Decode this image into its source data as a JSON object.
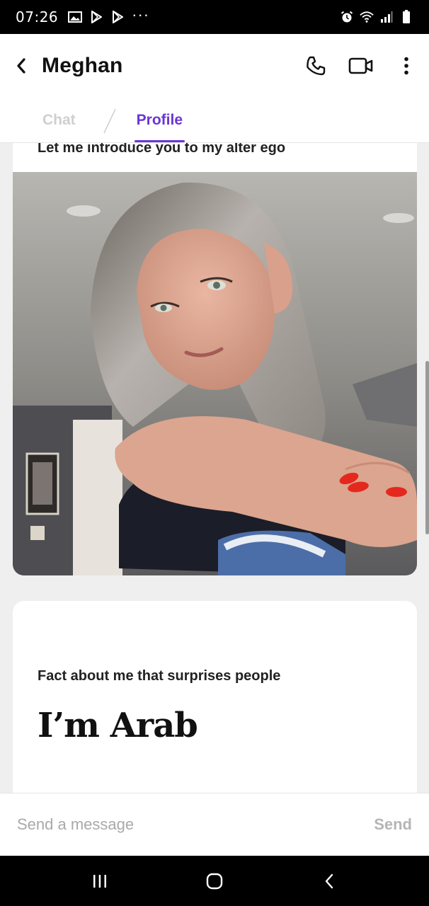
{
  "status_bar": {
    "time": "07:26",
    "left_icons": [
      "image-icon",
      "play-store-icon",
      "play-store-icon"
    ],
    "more": "···",
    "right_icons": [
      "alarm-icon",
      "wifi-icon",
      "signal-icon",
      "battery-icon"
    ]
  },
  "header": {
    "title": "Meghan",
    "back_icon": "chevron-left-icon",
    "actions": [
      "phone-icon",
      "video-camera-icon",
      "more-vertical-icon"
    ]
  },
  "tabs": [
    {
      "label": "Chat",
      "active": false
    },
    {
      "label": "Profile",
      "active": true
    }
  ],
  "profile": {
    "photo_card": {
      "prompt": "Let me introduce you to my alter ego"
    },
    "prompt_card": {
      "prompt": "Fact about me that surprises people",
      "answer": "I’m Arab"
    }
  },
  "message_bar": {
    "placeholder": "Send a message",
    "send_label": "Send"
  },
  "colors": {
    "accent": "#6a36d6",
    "inactive_tab": "#cfcfcf",
    "background": "#efefef"
  },
  "nav_bar": [
    "recents-icon",
    "home-icon",
    "back-icon"
  ]
}
